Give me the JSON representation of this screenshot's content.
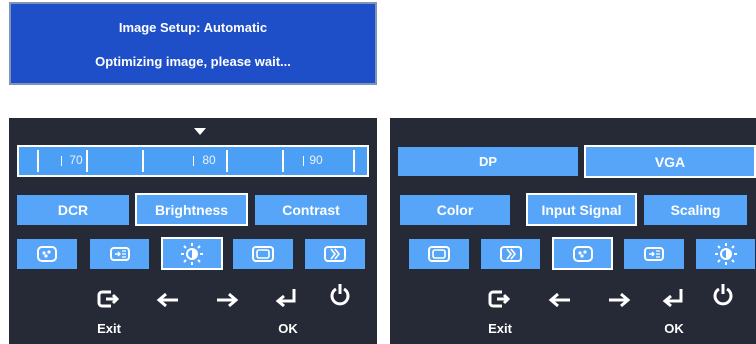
{
  "status_box": {
    "line1": "Image Setup: Automatic",
    "line2": "Optimizing image, please wait..."
  },
  "left_panel": {
    "slider": {
      "tick_labels": [
        "70",
        "80",
        "90"
      ],
      "value": 80
    },
    "buttons": [
      "DCR",
      "Brightness",
      "Contrast"
    ],
    "selected_button": "Brightness",
    "icons": [
      "color-icon",
      "input-signal-icon",
      "brightness-icon",
      "scaling-icon",
      "contrast-icon"
    ],
    "selected_icon": "brightness-icon"
  },
  "right_panel": {
    "inputs": [
      "DP",
      "VGA"
    ],
    "selected_input": "VGA",
    "buttons": [
      "Color",
      "Input Signal",
      "Scaling"
    ],
    "selected_button": "Input Signal",
    "icons": [
      "scaling-icon",
      "contrast-icon",
      "color-icon",
      "input-signal-icon",
      "brightness-icon"
    ],
    "selected_icon": "color-icon"
  },
  "controls": {
    "exit_label": "Exit",
    "ok_label": "OK"
  },
  "colors": {
    "status_bg": "#1f4fc8",
    "osd_bg": "#262936",
    "button_bg": "#57a5f8",
    "highlight": "#ffffff"
  }
}
